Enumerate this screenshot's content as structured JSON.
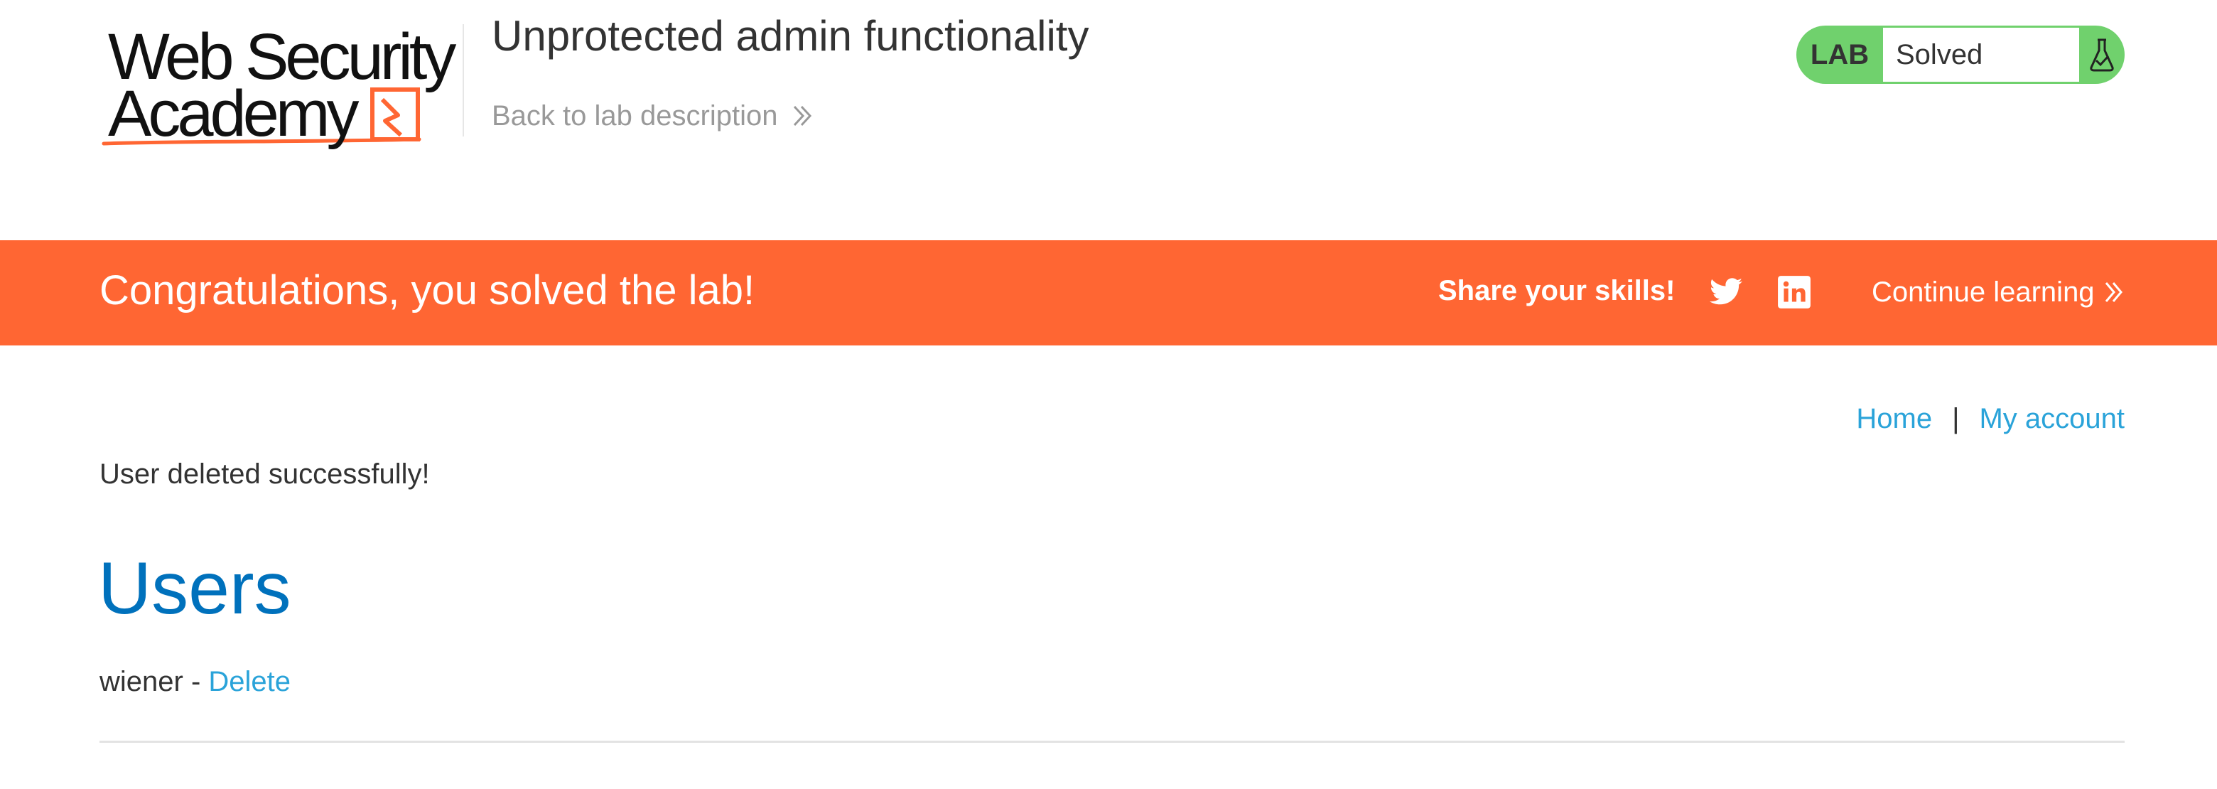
{
  "header": {
    "logo": {
      "line1": "Web Security",
      "line2": "Academy",
      "brand_color": "#ff6633"
    },
    "lab_title": "Unprotected admin functionality",
    "back_link_label": "Back to lab description",
    "back_link_icon": "double-chevron-right-icon",
    "status": {
      "tag": "LAB",
      "value": "Solved",
      "icon": "flask-icon",
      "color": "#70d16d"
    }
  },
  "banner": {
    "message": "Congratulations, you solved the lab!",
    "share_label": "Share your skills!",
    "social_icons": [
      "twitter-icon",
      "linkedin-icon"
    ],
    "continue_label": "Continue learning",
    "background_color": "#ff6633"
  },
  "nav": {
    "home_label": "Home",
    "separator": "|",
    "account_label": "My account",
    "link_color": "#2aa3d9"
  },
  "main": {
    "notice": "User deleted successfully!",
    "section_title": "Users",
    "title_color": "#0071bc",
    "users": [
      {
        "name": "wiener",
        "separator": " - ",
        "action_label": "Delete"
      }
    ]
  }
}
